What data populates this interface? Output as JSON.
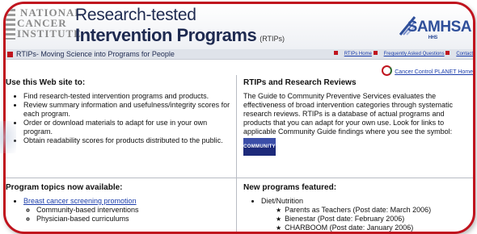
{
  "header": {
    "logo_lines": [
      "NATIONAL",
      "CANCER",
      "INSTITUTE"
    ],
    "title_line1": "Research-tested",
    "title_line2": "Intervention Programs",
    "title_abbrev": "(RTIPs)",
    "partner_logo": "SAMHSA",
    "partner_sub": "HHS"
  },
  "tagline": "RTIPs- Moving Science into Programs for People",
  "top_links": [
    "RTIPs Home",
    "Frequently Asked Questions",
    "Contact"
  ],
  "planet_link": "Cancer Control PLANET Home",
  "use_site": {
    "heading": "Use this Web site to:",
    "items": [
      "Find research-tested intervention programs and products.",
      "Review summary information and usefulness/integrity scores for each program.",
      "Order or download materials to adapt for use in your own program.",
      "Obtain readability scores for products distributed to the public."
    ]
  },
  "rtips_reviews": {
    "heading": "RTIPs and Research Reviews",
    "body": "The Guide to Community Preventive Services evaluates the effectiveness of broad intervention categories through systematic research reviews. RTIPs is a database of actual programs and products that you can adapt for your own use. Look for links to applicable Community Guide findings where you see the symbol:",
    "badge": "COMMUNITY"
  },
  "program_topics": {
    "heading": "Program topics now available:",
    "topic": "Breast cancer screening promotion",
    "subitems": [
      "Community-based interventions",
      "Physician-based curriculums"
    ]
  },
  "new_programs": {
    "heading": "New programs featured:",
    "category": "Diet/Nutrition",
    "items": [
      "Parents as Teachers (Post date: March 2006)",
      "Bienestar (Post date: February 2006)",
      "CHARBOOM (Post date: January 2006)"
    ]
  },
  "colors": {
    "accent_red": "#c0141e",
    "navy": "#1e2a50",
    "link_blue": "#1a3caa"
  }
}
